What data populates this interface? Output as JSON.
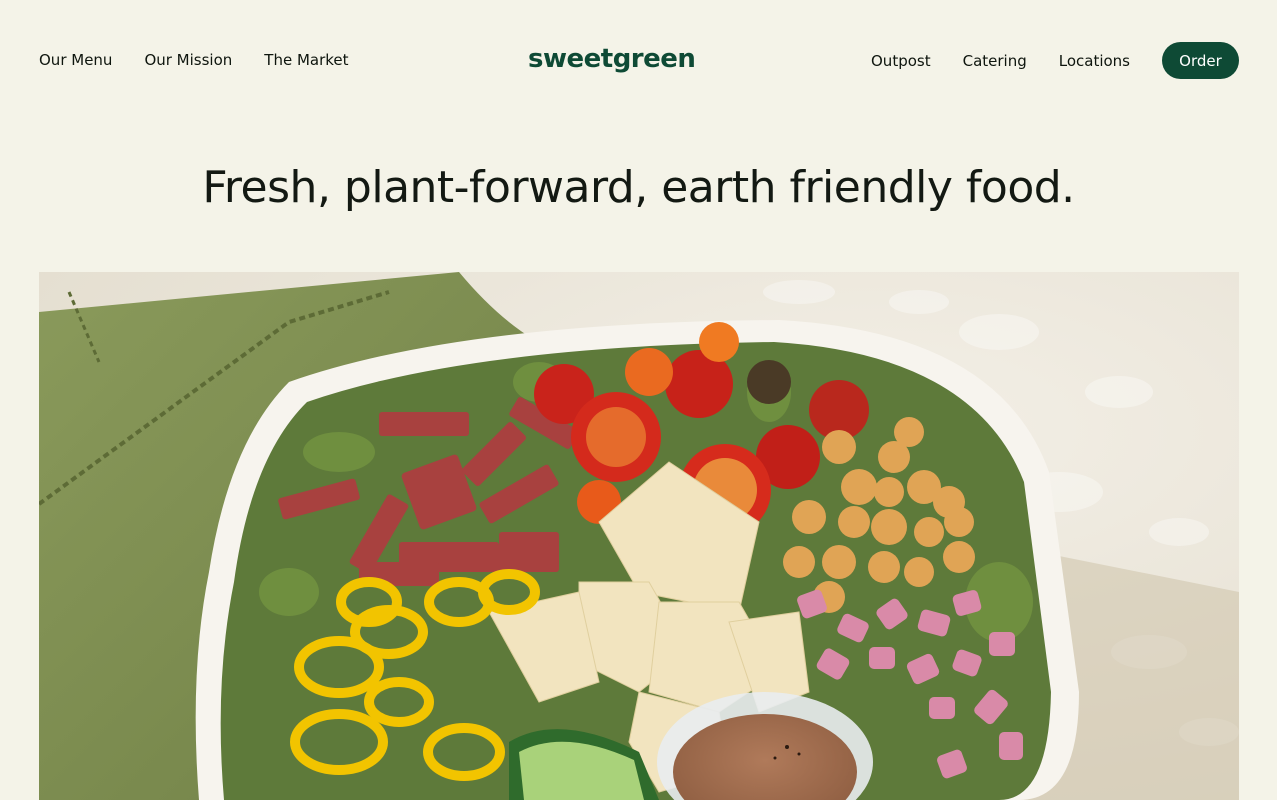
{
  "nav": {
    "left": [
      "Our Menu",
      "Our Mission",
      "The Market"
    ],
    "right": [
      "Outpost",
      "Catering",
      "Locations"
    ],
    "order_label": "Order"
  },
  "brand": {
    "logo_text": "sweetgreen",
    "accent_color": "#0e4a35",
    "background_color": "#f4f3e8"
  },
  "hero": {
    "headline": "Fresh, plant-forward, earth friendly food.",
    "image_subject": "salad-bowl-photo"
  }
}
